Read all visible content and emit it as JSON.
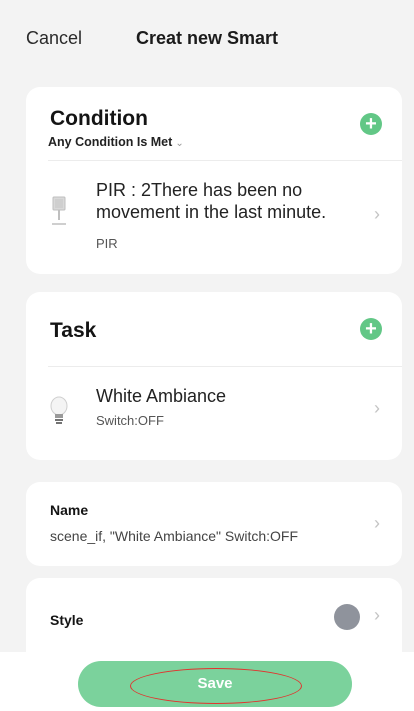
{
  "nav": {
    "cancel_label": "Cancel",
    "title": "Creat new Smart"
  },
  "condition": {
    "title": "Condition",
    "mode": "Any Condition Is Met",
    "add_icon": "plus-circle-icon",
    "items": [
      {
        "icon": "motion-sensor-icon",
        "text": "PIR : 2There has been no movement in the last minute.",
        "device": "PIR"
      }
    ]
  },
  "task": {
    "title": "Task",
    "add_icon": "plus-circle-icon",
    "items": [
      {
        "icon": "light-bulb-icon",
        "text": "White Ambiance",
        "action": "Switch:OFF"
      }
    ]
  },
  "name": {
    "label": "Name",
    "value": "scene_if, \"White Ambiance\" Switch:OFF"
  },
  "style": {
    "label": "Style",
    "color": "#8f939c"
  },
  "footer": {
    "save_label": "Save"
  },
  "colors": {
    "accent": "#62c786",
    "save_button": "#7bd29c",
    "annotation_ring": "#e2332e"
  }
}
